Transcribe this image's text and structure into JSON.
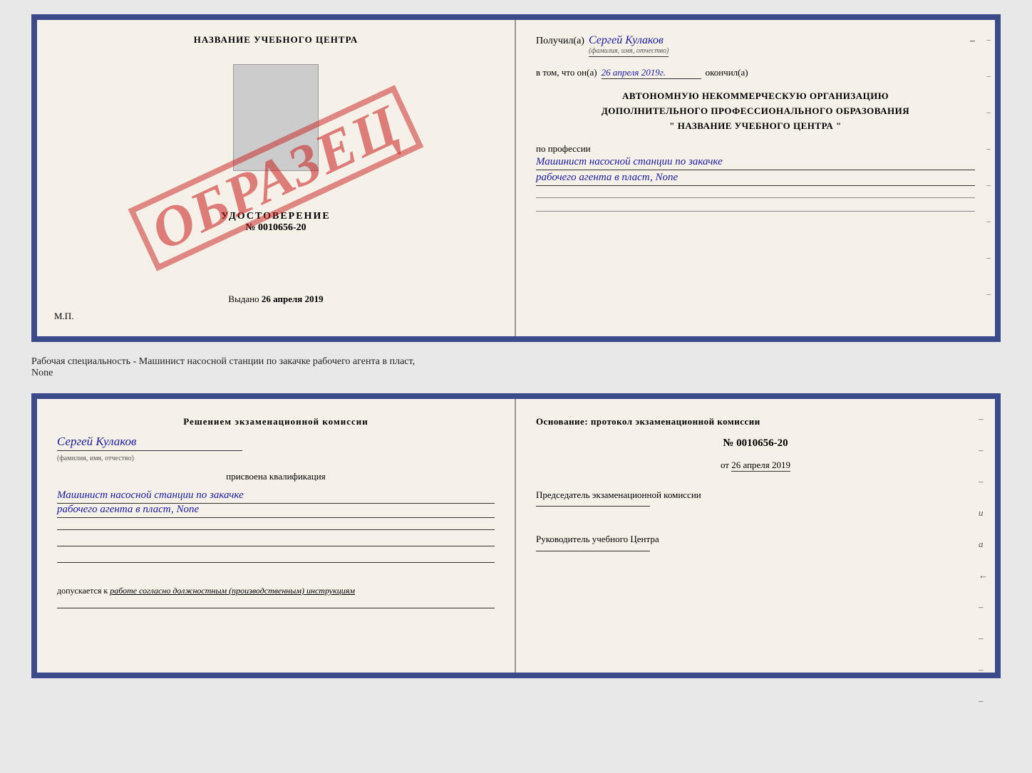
{
  "top_doc": {
    "left": {
      "center_title": "НАЗВАНИЕ УЧЕБНОГО ЦЕНТРА",
      "udost_label": "УДОСТОВЕРЕНИЕ",
      "udost_number": "№ 0010656-20",
      "vydano_label": "Выдано",
      "vydano_date": "26 апреля 2019",
      "mp_label": "М.П.",
      "obrazec": "ОБРАЗЕЦ"
    },
    "right": {
      "poluchil_label": "Получил(а)",
      "poluchil_name": "Сергей Кулаков",
      "fio_hint": "(фамилия, имя, отчество)",
      "vtom_label": "в том, что он(а)",
      "vtom_date": "26 апреля 2019г.",
      "okonchil_label": "окончил(а)",
      "org_line1": "АВТОНОМНУЮ НЕКОММЕРЧЕСКУЮ ОРГАНИЗАЦИЮ",
      "org_line2": "ДОПОЛНИТЕЛЬНОГО ПРОФЕССИОНАЛЬНОГО ОБРАЗОВАНИЯ",
      "org_quote": "\"",
      "org_name": "НАЗВАНИЕ УЧЕБНОГО ЦЕНТРА",
      "org_quote2": "\"",
      "po_professii_label": "по профессии",
      "profession_line1": "Машинист насосной станции по закачке",
      "profession_line2": "рабочего агента в пласт, None"
    }
  },
  "separator": "Рабочая специальность - Машинист насосной станции по закачке рабочего агента в пласт,",
  "separator2": "None",
  "bottom_doc": {
    "left": {
      "resolution_title": "Решением экзаменационной комиссии",
      "name": "Сергей Кулаков",
      "fio_hint": "(фамилия, имя, отчество)",
      "prisvoena_label": "присвоена квалификация",
      "qual_line1": "Машинист насосной станции по закачке",
      "qual_line2": "рабочего агента в пласт, None",
      "dopuskaetsya_label": "допускается к",
      "dopuskaetsya_val": "работе согласно должностным (производственным) инструкциям"
    },
    "right": {
      "osnov_label": "Основание: протокол экзаменационной комиссии",
      "protocol_label": "№",
      "protocol_number": "0010656-20",
      "ot_label": "от",
      "ot_date": "26 апреля 2019",
      "predsedatel_label": "Председатель экзаменационной комиссии",
      "rukovoditel_label": "Руководитель учебного Центра"
    }
  }
}
